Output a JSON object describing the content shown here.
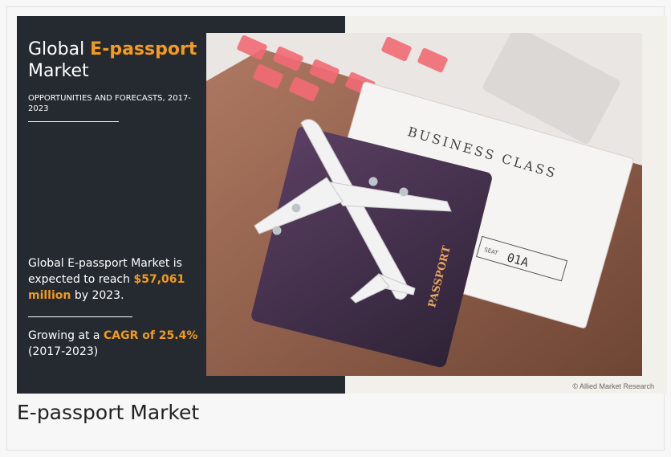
{
  "infographic": {
    "title_prefix": "Global ",
    "title_accent": "E-passport",
    "title_line2": "Market",
    "subtitle": "OPPORTUNITIES AND FORECASTS, 2017-2023",
    "stat1_pre": "Global E-passport Market is expected to reach ",
    "stat1_accent": "$57,061 million",
    "stat1_post": " by 2023.",
    "stat2_pre": "Growing at a ",
    "stat2_accent": "CAGR of 25.4%",
    "stat2_post": "(2017-2023)",
    "ticket_text": "BUSINESS CLASS",
    "seat_label": "SEAT",
    "seat_value": "01A",
    "passport_text": "PASSPORT",
    "copyright": "© Allied Market Research"
  },
  "caption": "E-passport Market",
  "colors": {
    "accent": "#f39a1f",
    "dark_panel": "#242a30"
  }
}
